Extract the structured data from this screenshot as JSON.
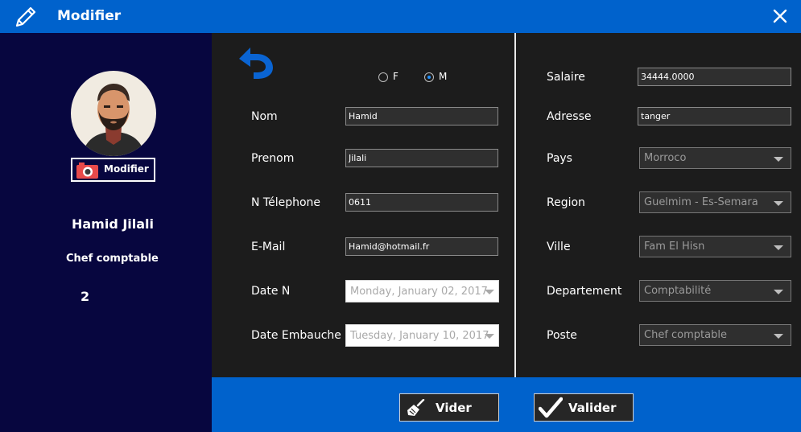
{
  "window": {
    "title": "Modifier"
  },
  "profile": {
    "photo_button_label": "Modifier",
    "name": "Hamid Jilali",
    "role": "Chef comptable",
    "id": "2"
  },
  "gender": {
    "options": [
      {
        "label": "F",
        "selected": false
      },
      {
        "label": "M",
        "selected": true
      }
    ]
  },
  "form_left": {
    "nom": {
      "label": "Nom",
      "value": "Hamid"
    },
    "prenom": {
      "label": "Prenom",
      "value": "Jilali"
    },
    "telephone": {
      "label": "N Télephone",
      "value": "0611"
    },
    "email": {
      "label": "E-Mail",
      "value": "Hamid@hotmail.fr"
    },
    "date_naissance": {
      "label": "Date N",
      "value": "Monday, January 02, 2017"
    },
    "date_embauche": {
      "label": "Date Embauche",
      "value": "Tuesday, January 10, 2017"
    }
  },
  "form_right": {
    "salaire": {
      "label": "Salaire",
      "value": "34444.0000"
    },
    "adresse": {
      "label": "Adresse",
      "value": "tanger"
    },
    "pays": {
      "label": "Pays",
      "value": "Morroco"
    },
    "region": {
      "label": "Region",
      "value": "Guelmim - Es-Semara"
    },
    "ville": {
      "label": "Ville",
      "value": "Fam El Hisn"
    },
    "departement": {
      "label": "Departement",
      "value": "Comptabilité"
    },
    "poste": {
      "label": "Poste",
      "value": "Chef comptable"
    }
  },
  "buttons": {
    "vider": "Vider",
    "valider": "Valider"
  },
  "colors": {
    "accent": "#0062cc",
    "sidebar": "#07063f",
    "panel": "#1c1c1c",
    "radio_selected": "#1e90ff"
  },
  "icons": {
    "title": "pencil-icon",
    "close": "close-icon",
    "back": "undo-arrow-icon",
    "camera": "camera-icon",
    "vider": "broom-icon",
    "valider": "checkmark-icon"
  }
}
